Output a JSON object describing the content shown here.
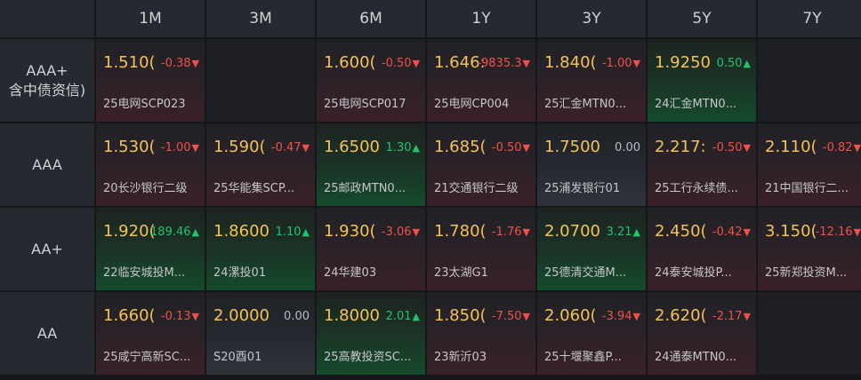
{
  "headers": [
    "1M",
    "3M",
    "6M",
    "1Y",
    "3Y",
    "5Y",
    "7Y"
  ],
  "rows": [
    {
      "label": [
        "AAA+",
        "含中债资信)"
      ],
      "cells": [
        {
          "value": "1.510(",
          "change": "-0.38",
          "dir": "neg",
          "name": "25电网SCP023",
          "tone": "red"
        },
        null,
        {
          "value": "1.600(",
          "change": "-0.50",
          "dir": "neg",
          "name": "25电网SCP017",
          "tone": "red"
        },
        {
          "value": "1.646:",
          "change": "-9835.3",
          "dir": "neg",
          "name": "25电网CP004",
          "tone": "red"
        },
        {
          "value": "1.840(",
          "change": "-1.00",
          "dir": "neg",
          "name": "25汇金MTN0...",
          "tone": "red"
        },
        {
          "value": "1.9250",
          "change": "0.50",
          "dir": "pos",
          "name": "24汇金MTN0...",
          "tone": "green"
        },
        null
      ]
    },
    {
      "label": [
        "AAA"
      ],
      "cells": [
        {
          "value": "1.530(",
          "change": "-1.00",
          "dir": "neg",
          "name": "20长沙银行二级",
          "tone": "red"
        },
        {
          "value": "1.590(",
          "change": "-0.47",
          "dir": "neg",
          "name": "25华能集SCP...",
          "tone": "red"
        },
        {
          "value": "1.6500",
          "change": "1.30",
          "dir": "pos",
          "name": "25邮政MTN0...",
          "tone": "green"
        },
        {
          "value": "1.685(",
          "change": "-0.50",
          "dir": "neg",
          "name": "21交通银行二级",
          "tone": "red"
        },
        {
          "value": "1.7500",
          "change": "0.00",
          "dir": "zero",
          "name": "25浦发银行01",
          "tone": "gray"
        },
        {
          "value": "2.217:",
          "change": "-0.50",
          "dir": "neg",
          "name": "25工行永续债...",
          "tone": "red"
        },
        {
          "value": "2.110(",
          "change": "-0.82",
          "dir": "neg",
          "name": "21中国银行二...",
          "tone": "red"
        }
      ]
    },
    {
      "label": [
        "AA+"
      ],
      "cells": [
        {
          "value": "1.920(",
          "change": "189.46",
          "dir": "pos",
          "name": "22临安城投M...",
          "tone": "green"
        },
        {
          "value": "1.8600",
          "change": "1.10",
          "dir": "pos",
          "name": "24漯投01",
          "tone": "green"
        },
        {
          "value": "1.930(",
          "change": "-3.06",
          "dir": "neg",
          "name": "24华建03",
          "tone": "red"
        },
        {
          "value": "1.780(",
          "change": "-1.76",
          "dir": "neg",
          "name": "23太湖G1",
          "tone": "red"
        },
        {
          "value": "2.0700",
          "change": "3.21",
          "dir": "pos",
          "name": "25德清交通M...",
          "tone": "green"
        },
        {
          "value": "2.450(",
          "change": "-0.42",
          "dir": "neg",
          "name": "24泰安城投P...",
          "tone": "red"
        },
        {
          "value": "3.150(",
          "change": "-12.16",
          "dir": "neg",
          "name": "25新郑投资M...",
          "tone": "red"
        }
      ]
    },
    {
      "label": [
        "AA"
      ],
      "cells": [
        {
          "value": "1.660(",
          "change": "-0.13",
          "dir": "neg",
          "name": "25咸宁高新SC...",
          "tone": "red"
        },
        {
          "value": "2.0000",
          "change": "0.00",
          "dir": "zero",
          "name": "S20酉01",
          "tone": "gray"
        },
        {
          "value": "1.8000",
          "change": "2.01",
          "dir": "pos",
          "name": "25高教投资SC...",
          "tone": "green"
        },
        {
          "value": "1.850(",
          "change": "-7.50",
          "dir": "neg",
          "name": "23新沂03",
          "tone": "red"
        },
        {
          "value": "2.060(",
          "change": "-3.94",
          "dir": "neg",
          "name": "25十堰聚鑫P...",
          "tone": "red"
        },
        {
          "value": "2.620(",
          "change": "-2.17",
          "dir": "neg",
          "name": "24通泰MTN0...",
          "tone": "red"
        },
        null
      ]
    }
  ],
  "icons": {
    "down": "down-triangle-icon",
    "up": "up-triangle-icon"
  },
  "colors": {
    "value": "#f3c25a",
    "negative": "#f2504a",
    "positive": "#22c36e",
    "neutral": "#b8bcc2"
  }
}
